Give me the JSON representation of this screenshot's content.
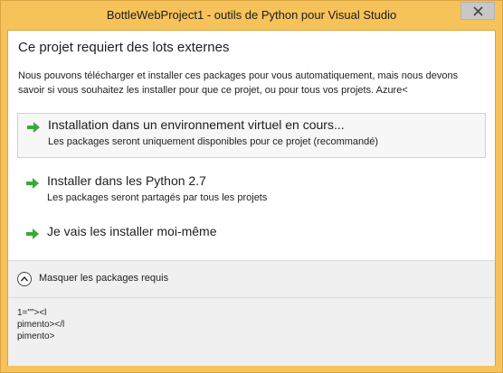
{
  "window": {
    "title": "BottleWebProject1 - outils de Python pour Visual Studio",
    "close_glyph": "✕"
  },
  "dialog": {
    "heading": "Ce projet requiert des lots externes",
    "description": "Nous pouvons télécharger et installer ces packages pour vous automatiquement, mais nous devons savoir si vous souhaitez les installer pour que ce projet, ou pour tous vos projets. Azure<",
    "options": [
      {
        "icon": "green-arrow-icon",
        "title": "Installation dans un environnement virtuel en cours...",
        "subtitle": "Les packages seront uniquement disponibles pour ce projet (recommandé)"
      },
      {
        "icon": "green-arrow-icon",
        "title": "Installer dans les Python 2.7",
        "subtitle": "Les packages seront partagés par tous les projets"
      },
      {
        "icon": "green-arrow-icon",
        "title": "Je vais les installer moi-même",
        "subtitle": ""
      }
    ],
    "toggle_label": "Masquer les packages requis",
    "packages": [
      "1=\"\"><l",
      "pimento></l",
      "pimento>"
    ]
  },
  "colors": {
    "title_bar": "#f6c25a",
    "arrow_green": "#3aa935"
  }
}
